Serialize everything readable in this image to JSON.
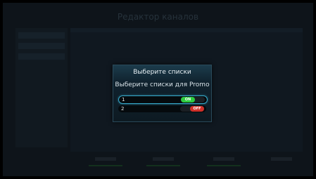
{
  "background": {
    "title": "Редактор каналов"
  },
  "dialog": {
    "title": "Выберите списки",
    "subtitle": "Выберите списки для Promo",
    "items": [
      {
        "label": "1",
        "state": "ON",
        "selected": true,
        "color": "#2ecc40"
      },
      {
        "label": "2",
        "state": "OFF",
        "selected": false,
        "color": "#d0302a"
      }
    ]
  },
  "colors": {
    "accent": "#35a8c8",
    "on": "#2ecc40",
    "off": "#d0302a"
  }
}
